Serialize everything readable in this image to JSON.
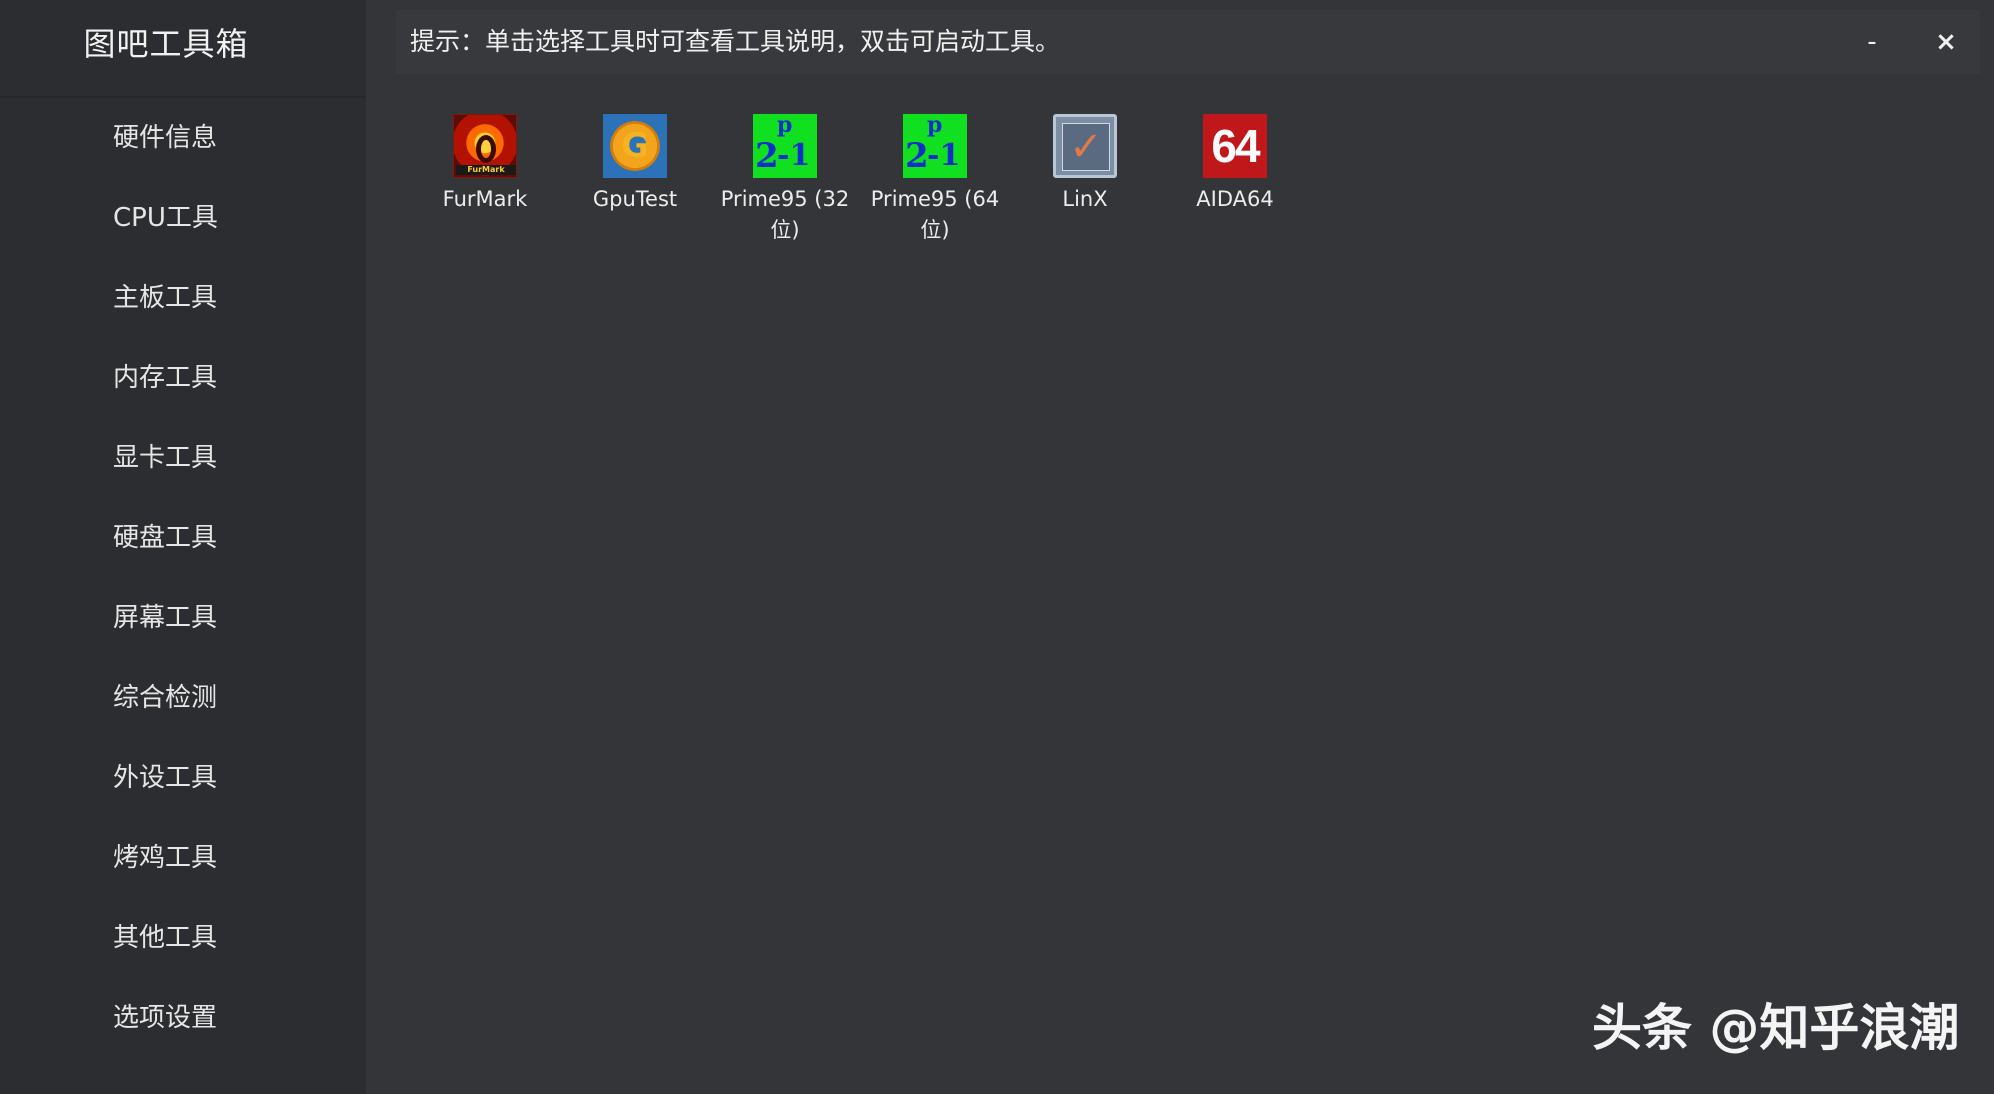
{
  "app": {
    "title": "图吧工具箱"
  },
  "sidebar": {
    "items": [
      {
        "label": "硬件信息"
      },
      {
        "label": "CPU工具"
      },
      {
        "label": "主板工具"
      },
      {
        "label": "内存工具"
      },
      {
        "label": "显卡工具"
      },
      {
        "label": "硬盘工具"
      },
      {
        "label": "屏幕工具"
      },
      {
        "label": "综合检测"
      },
      {
        "label": "外设工具"
      },
      {
        "label": "烤鸡工具"
      },
      {
        "label": "其他工具"
      },
      {
        "label": "选项设置"
      }
    ]
  },
  "header": {
    "hint": "提示：单击选择工具时可查看工具说明，双击可启动工具。",
    "minimize_label": "-",
    "close_label": "×"
  },
  "tools": [
    {
      "label": "FurMark",
      "icon": "furmark-icon",
      "icon_text": "FurMark"
    },
    {
      "label": "GpuTest",
      "icon": "gputest-icon",
      "icon_text": "G"
    },
    {
      "label": "Prime95 (32位)",
      "icon": "prime95-icon",
      "icon_text": "2p-1"
    },
    {
      "label": "Prime95 (64位)",
      "icon": "prime95-icon",
      "icon_text": "2p-1"
    },
    {
      "label": "LinX",
      "icon": "linx-checkbox-icon"
    },
    {
      "label": "AIDA64",
      "icon": "aida64-icon",
      "icon_text": "64"
    }
  ],
  "watermark": {
    "text": "头条 @知乎浪潮"
  },
  "colors": {
    "background": "#343538",
    "sidebar": "#2c2d30",
    "hint_bar": "#38393c",
    "text": "#ececec"
  }
}
